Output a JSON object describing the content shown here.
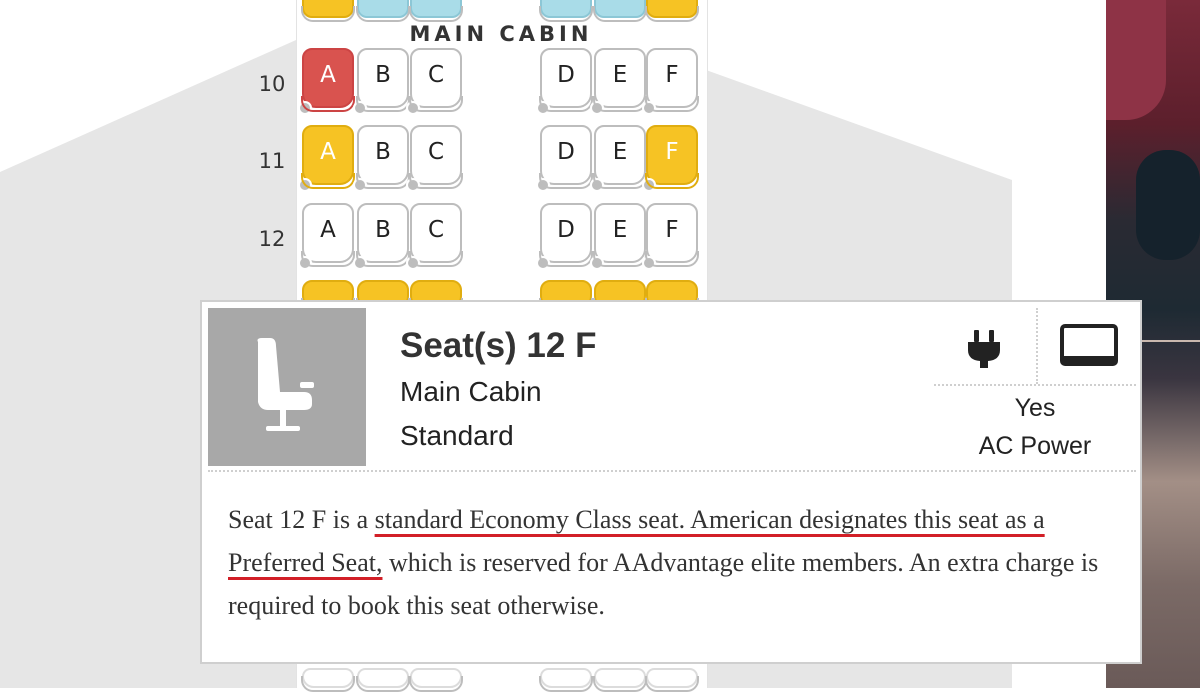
{
  "cabin_label": "MAIN CABIN",
  "seat_map": {
    "rows": [
      {
        "number": "10",
        "seats": [
          {
            "letter": "A",
            "status": "unavailable"
          },
          {
            "letter": "B",
            "status": "available"
          },
          {
            "letter": "C",
            "status": "available"
          },
          {
            "letter": "D",
            "status": "available"
          },
          {
            "letter": "E",
            "status": "available"
          },
          {
            "letter": "F",
            "status": "available"
          }
        ]
      },
      {
        "number": "11",
        "seats": [
          {
            "letter": "A",
            "status": "preferred"
          },
          {
            "letter": "B",
            "status": "available"
          },
          {
            "letter": "C",
            "status": "available"
          },
          {
            "letter": "D",
            "status": "available"
          },
          {
            "letter": "E",
            "status": "available"
          },
          {
            "letter": "F",
            "status": "preferred"
          }
        ]
      },
      {
        "number": "12",
        "seats": [
          {
            "letter": "A",
            "status": "available"
          },
          {
            "letter": "B",
            "status": "available"
          },
          {
            "letter": "C",
            "status": "available"
          },
          {
            "letter": "D",
            "status": "available"
          },
          {
            "letter": "E",
            "status": "available"
          },
          {
            "letter": "F",
            "status": "available"
          }
        ]
      }
    ]
  },
  "seat_detail": {
    "title": "Seat(s) 12 F",
    "cabin": "Main Cabin",
    "type": "Standard",
    "thumbnail_icon": "seat-icon",
    "amenities": {
      "power_icon": "plug-icon",
      "screen_icon": "screen-icon",
      "power_value": "Yes",
      "power_label": "AC Power"
    },
    "description": {
      "part1": "Seat 12 F is a ",
      "highlight1": "standard Economy Class seat. American designates this seat as a Preferred Seat,",
      "part2": " which is reserved for AAdvantage elite members. An extra charge is required to book this seat otherwise."
    }
  },
  "colors": {
    "unavailable": "#d9534f",
    "preferred": "#f6c324",
    "exit_row": "#a9dce8",
    "underline": "#d21f27",
    "thumbnail_bg": "#a8a8a8"
  }
}
